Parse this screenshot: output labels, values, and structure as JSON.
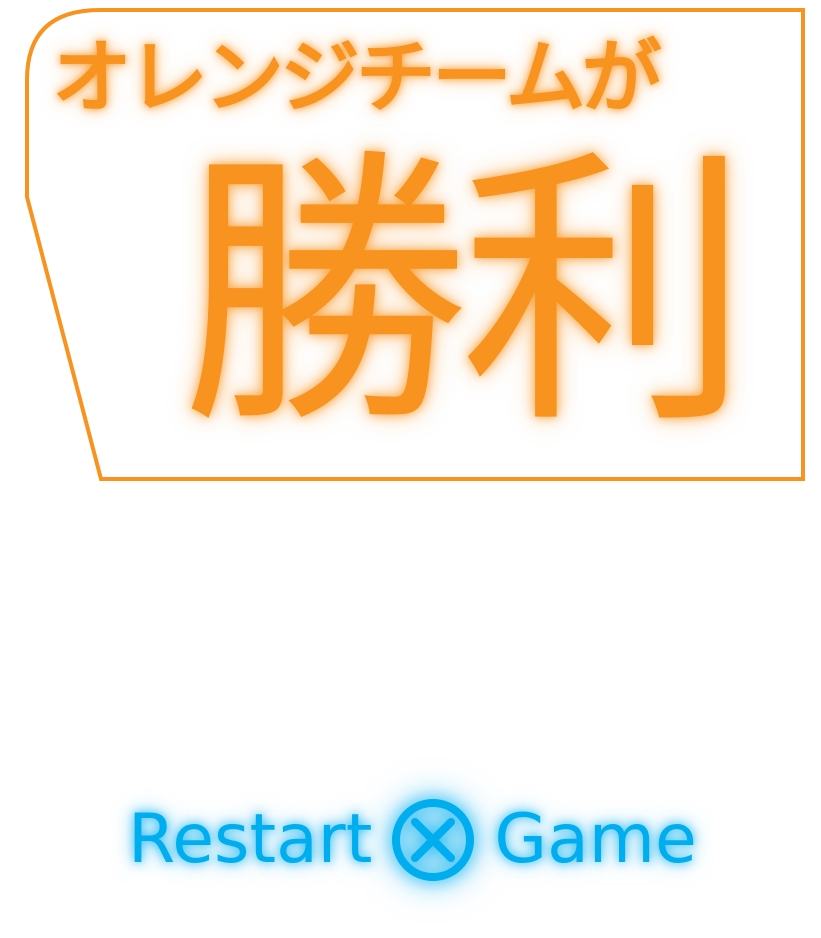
{
  "banner": {
    "team_line": "オレンジチームが",
    "result_line": "勝利"
  },
  "restart": {
    "word1": "Restart",
    "button_icon": "x-button-icon",
    "word2": "Game"
  },
  "colors": {
    "orange": "#f7931e",
    "blue": "#00aeef",
    "background": "#ffffff"
  }
}
